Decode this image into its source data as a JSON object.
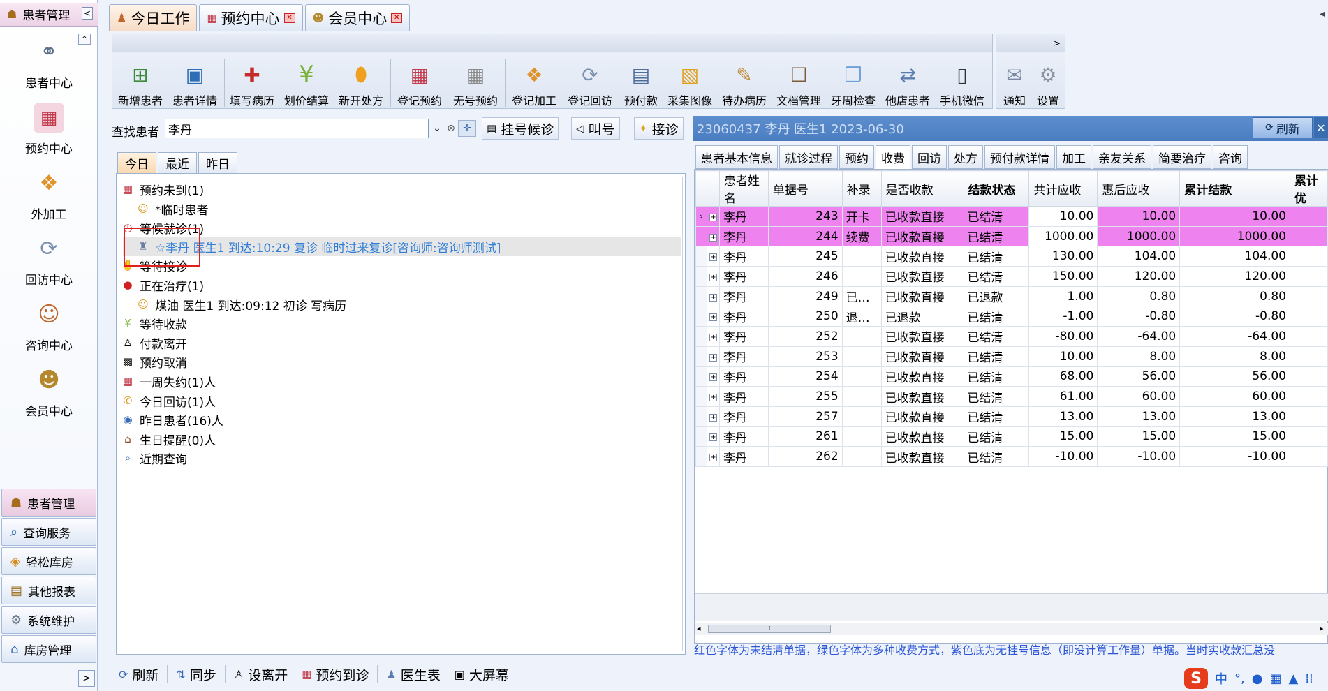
{
  "sidebar": {
    "header": "患者管理",
    "collapse_glyph": "<",
    "up_glyph": "^",
    "items": [
      {
        "label": "患者中心",
        "icon": "binoculars-icon"
      },
      {
        "label": "预约中心",
        "icon": "calendar-icon"
      },
      {
        "label": "外加工",
        "icon": "cubes-icon"
      },
      {
        "label": "回访中心",
        "icon": "refresh-icon"
      },
      {
        "label": "咨询中心",
        "icon": "consultant-icon"
      },
      {
        "label": "会员中心",
        "icon": "members-icon"
      }
    ],
    "bottom_items": [
      {
        "label": "患者管理",
        "icon": "users-icon"
      },
      {
        "label": "查询服务",
        "icon": "search-icon"
      },
      {
        "label": "轻松库房",
        "icon": "box-icon"
      },
      {
        "label": "其他报表",
        "icon": "printer-icon"
      },
      {
        "label": "系统维护",
        "icon": "gears-icon"
      },
      {
        "label": "库房管理",
        "icon": "warehouse-icon"
      }
    ],
    "expand_glyph": ">"
  },
  "tabs": [
    {
      "label": "今日工作",
      "closable": false
    },
    {
      "label": "预约中心",
      "closable": true
    },
    {
      "label": "会员中心",
      "closable": true
    }
  ],
  "toolbar": {
    "groups": [
      [
        "新增患者",
        "患者详情"
      ],
      [
        "填写病历",
        "划价结算",
        "新开处方"
      ],
      [
        "登记预约",
        "无号预约"
      ],
      [
        "登记加工",
        "登记回访",
        "预付款",
        "采集图像",
        "待办病历",
        "文档管理",
        "牙周检查",
        "他店患者",
        "手机微信"
      ]
    ],
    "extra": [
      "通知",
      "设置"
    ],
    "more_glyph": ">"
  },
  "search": {
    "label": "查找患者",
    "value": "李丹",
    "buttons": [
      "挂号候诊",
      "叫号",
      "接诊"
    ]
  },
  "list_tabs": [
    "今日",
    "最近",
    "昨日"
  ],
  "tree": [
    {
      "text": "预约未到(1)",
      "level": 0,
      "icon": "calendar-icon"
    },
    {
      "text": "*临时患者",
      "level": 1,
      "icon": "mask-icon"
    },
    {
      "text": "等候就诊(1)",
      "level": 0,
      "icon": "clock-icon"
    },
    {
      "text": "☆李丹   医生1  到达:10:29 复诊  临时过来复诊[咨询师:咨询师测试]",
      "level": 1,
      "icon": "patient-icon",
      "selected": true
    },
    {
      "text": "等待接诊",
      "level": 0,
      "icon": "handshake-icon"
    },
    {
      "text": "正在治疗(1)",
      "level": 0,
      "icon": "drop-icon"
    },
    {
      "text": "煤油  医生1  到达:09:12 初诊  写病历",
      "level": 1,
      "icon": "mask-icon"
    },
    {
      "text": "等待收款",
      "level": 0,
      "icon": "yen-icon"
    },
    {
      "text": "付款离开",
      "level": 0,
      "icon": "walking-icon"
    },
    {
      "text": "预约取消",
      "level": 0,
      "icon": "calendar-cancel-icon"
    },
    {
      "text": "一周失约(1)人",
      "level": 0,
      "icon": "calendar-week-icon"
    },
    {
      "text": "今日回访(1)人",
      "level": 0,
      "icon": "phone-icon"
    },
    {
      "text": "昨日患者(16)人",
      "level": 0,
      "icon": "eye-icon"
    },
    {
      "text": "生日提醒(0)人",
      "level": 0,
      "icon": "cake-icon"
    },
    {
      "text": "近期查询",
      "level": 0,
      "icon": "magnifier-icon"
    }
  ],
  "detail": {
    "header": "23060437 李丹 医生1 2023-06-30",
    "refresh_label": "刷新",
    "close_glyph": "✕",
    "tabs": [
      "患者基本信息",
      "就诊过程",
      "预约",
      "收费",
      "回访",
      "处方",
      "预付款详情",
      "加工",
      "亲友关系",
      "简要治疗",
      "咨询"
    ],
    "active_tab": "收费",
    "columns": [
      "患者姓名",
      "单据号",
      "补录",
      "是否收款",
      "结款状态",
      "共计应收",
      "惠后应收",
      "累计结款",
      "累计优"
    ],
    "rows": [
      {
        "name": "李丹",
        "no": "243",
        "extra": "开卡",
        "paid": "已收款直接",
        "status": "已结清",
        "total": "10.00",
        "discounted": "10.00",
        "settled": "10.00",
        "highlight": true
      },
      {
        "name": "李丹",
        "no": "244",
        "extra": "续费",
        "paid": "已收款直接",
        "status": "已结清",
        "total": "1000.00",
        "discounted": "1000.00",
        "settled": "1000.00",
        "highlight": true
      },
      {
        "name": "李丹",
        "no": "245",
        "extra": "",
        "paid": "已收款直接",
        "status": "已结清",
        "total": "130.00",
        "discounted": "104.00",
        "settled": "104.00",
        "highlight": false
      },
      {
        "name": "李丹",
        "no": "246",
        "extra": "",
        "paid": "已收款直接",
        "status": "已结清",
        "total": "150.00",
        "discounted": "120.00",
        "settled": "120.00",
        "highlight": false
      },
      {
        "name": "李丹",
        "no": "249",
        "extra": "已…",
        "paid": "已收款直接",
        "status": "已退款",
        "total": "1.00",
        "discounted": "0.80",
        "settled": "0.80",
        "highlight": false
      },
      {
        "name": "李丹",
        "no": "250",
        "extra": "退…",
        "paid": "已退款",
        "status": "已结清",
        "total": "-1.00",
        "discounted": "-0.80",
        "settled": "-0.80",
        "highlight": false
      },
      {
        "name": "李丹",
        "no": "252",
        "extra": "",
        "paid": "已收款直接",
        "status": "已结清",
        "total": "-80.00",
        "discounted": "-64.00",
        "settled": "-64.00",
        "highlight": false
      },
      {
        "name": "李丹",
        "no": "253",
        "extra": "",
        "paid": "已收款直接",
        "status": "已结清",
        "total": "10.00",
        "discounted": "8.00",
        "settled": "8.00",
        "highlight": false
      },
      {
        "name": "李丹",
        "no": "254",
        "extra": "",
        "paid": "已收款直接",
        "status": "已结清",
        "total": "68.00",
        "discounted": "56.00",
        "settled": "56.00",
        "highlight": false
      },
      {
        "name": "李丹",
        "no": "255",
        "extra": "",
        "paid": "已收款直接",
        "status": "已结清",
        "total": "61.00",
        "discounted": "60.00",
        "settled": "60.00",
        "highlight": false
      },
      {
        "name": "李丹",
        "no": "257",
        "extra": "",
        "paid": "已收款直接",
        "status": "已结清",
        "total": "13.00",
        "discounted": "13.00",
        "settled": "13.00",
        "highlight": false
      },
      {
        "name": "李丹",
        "no": "261",
        "extra": "",
        "paid": "已收款直接",
        "status": "已结清",
        "total": "15.00",
        "discounted": "15.00",
        "settled": "15.00",
        "highlight": false
      },
      {
        "name": "李丹",
        "no": "262",
        "extra": "",
        "paid": "已收款直接",
        "status": "已结清",
        "total": "-10.00",
        "discounted": "-10.00",
        "settled": "-10.00",
        "highlight": false
      }
    ],
    "note": "红色字体为未结清单据，绿色字体为多种收费方式，紫色底为无挂号信息（即没计算工作量）单据。当时实收款汇总没"
  },
  "bottom_bar": [
    "刷新",
    "同步",
    "设离开",
    "预约到诊",
    "医生表",
    "大屏幕"
  ],
  "ime": {
    "logo": "S",
    "mode": "中"
  },
  "colors": {
    "highlight_row": "#ee82ee",
    "header_bar": "#4a7dc0",
    "note_text": "#2b55d6",
    "annotation_box": "#e0201c"
  }
}
